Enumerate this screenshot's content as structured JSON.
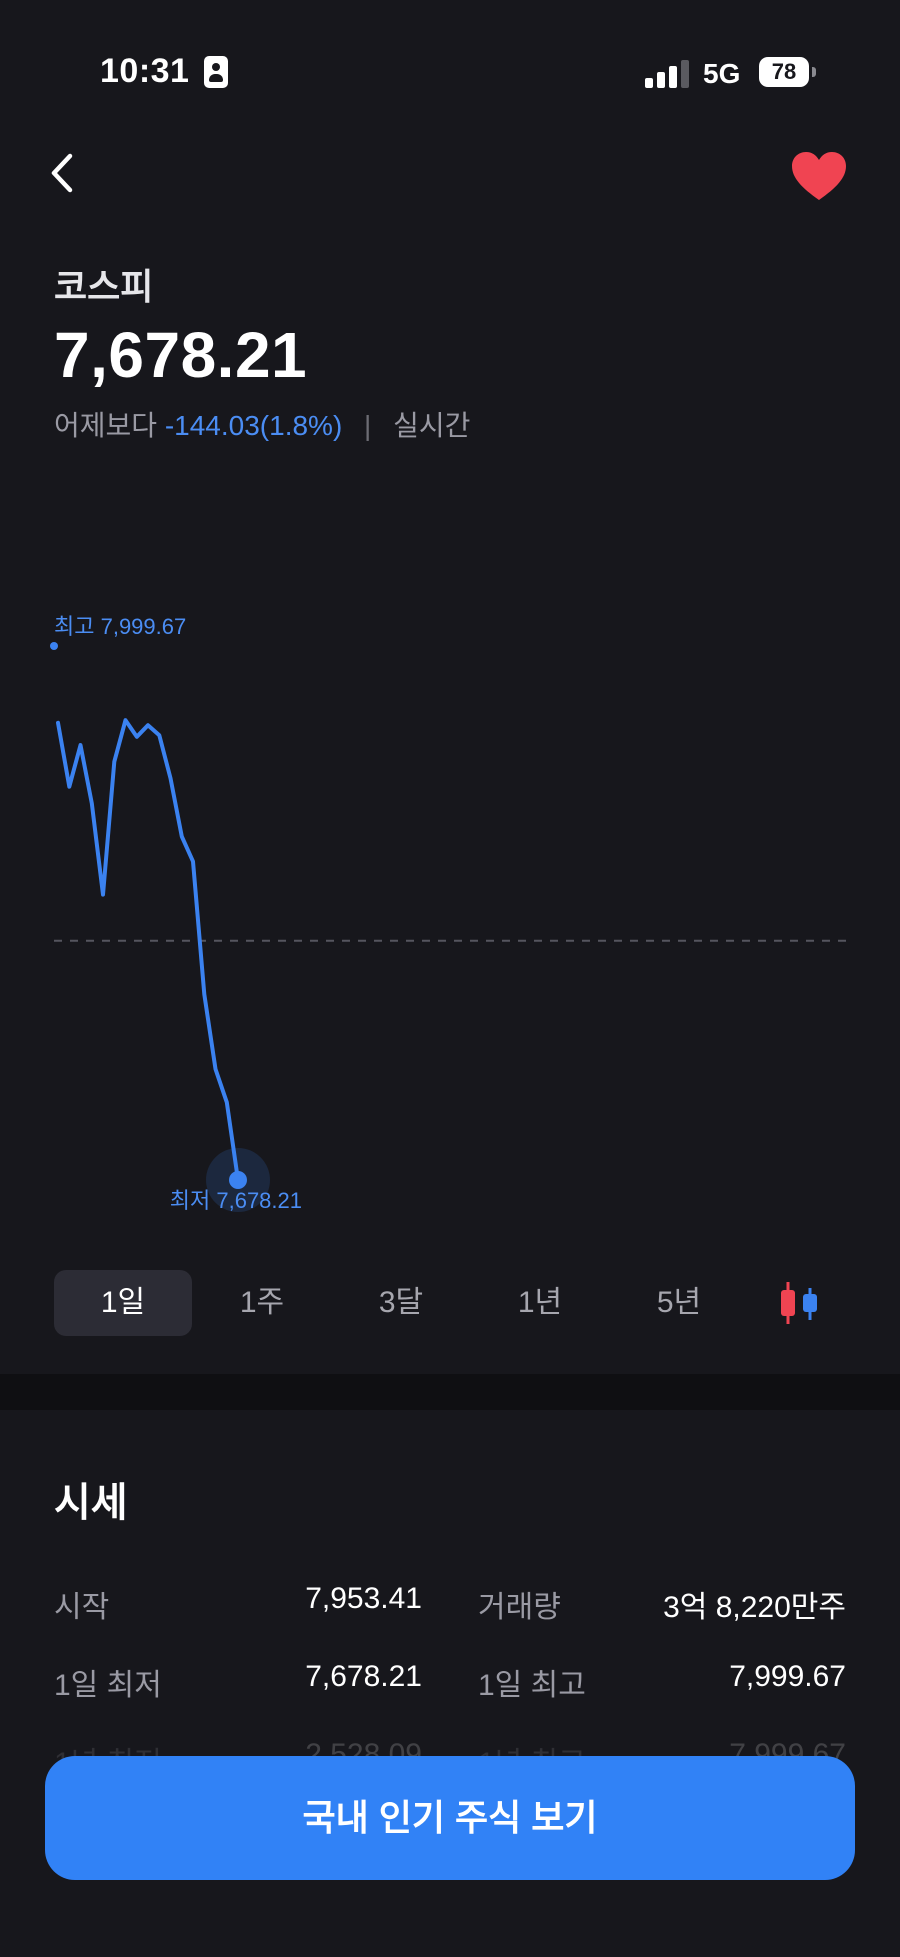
{
  "status_bar": {
    "time": "10:31",
    "network": "5G",
    "battery": "78"
  },
  "icons": {
    "back": "chevron-left-icon",
    "favorite": "heart-icon",
    "candle": "candlestick-chart-icon"
  },
  "colors": {
    "background": "#17171c",
    "accent": "#3182f6",
    "chart_line": "#3b82f0",
    "down": "#4b8df3",
    "favorite": "#f04452"
  },
  "index": {
    "name": "코스피",
    "value": "7,678.21",
    "change_prefix": "어제보다",
    "change": "-144.03(1.8%)",
    "separator": "|",
    "mode": "실시간"
  },
  "chart_data": {
    "type": "line",
    "high_label": "최고 7,999.67",
    "low_label": "최저 7,678.21",
    "high": 7999.67,
    "low": 7678.21,
    "previous_close": 7822.24,
    "y_range": [
      7678.21,
      7999.67
    ],
    "grid": false,
    "values": [
      7953.41,
      7915,
      7940,
      7905,
      7850,
      7930,
      7955,
      7945,
      7952,
      7946,
      7920,
      7885,
      7870,
      7790,
      7745,
      7725,
      7678.21
    ]
  },
  "periods": {
    "items": [
      "1일",
      "1주",
      "3달",
      "1년",
      "5년"
    ],
    "selected": "1일"
  },
  "quotes": {
    "title": "시세",
    "rows": [
      {
        "l1": "시작",
        "v1": "7,953.41",
        "l2": "거래량",
        "v2": "3억 8,220만주"
      },
      {
        "l1": "1일 최저",
        "v1": "7,678.21",
        "l2": "1일 최고",
        "v2": "7,999.67"
      },
      {
        "l1": "1년 최저",
        "v1": "2,528.09",
        "l2": "1년 최고",
        "v2": "7,999.67"
      }
    ]
  },
  "cta": {
    "label": "국내 인기 주식 보기"
  }
}
